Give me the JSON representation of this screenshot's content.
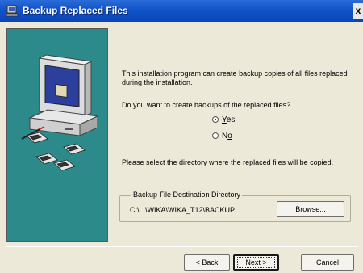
{
  "window": {
    "title": "Backup Replaced Files",
    "close_glyph": "x",
    "title_icon": "installer-icon"
  },
  "content": {
    "intro": "This installation program can create backup copies of all files replaced during the installation.",
    "question": "Do you want to create backups of the replaced files?",
    "radios": [
      {
        "label_prefix": "",
        "label_accel": "Y",
        "label_rest": "es",
        "checked": true
      },
      {
        "label_prefix": "N",
        "label_accel": "o",
        "label_rest": "",
        "checked": false
      }
    ],
    "select_dir_text": "Please select the directory where the replaced  files will be copied.",
    "group_label": "Backup File Destination Directory",
    "destination_path": "C:\\...\\WIKA\\WIKA_T12\\BACKUP",
    "browse_label": "Browse..."
  },
  "footer": {
    "back_label": "< Back",
    "next_label": "Next >",
    "cancel_label": "Cancel"
  },
  "colors": {
    "titlebar": "#1152c8",
    "side_panel": "#2d8a8a",
    "dialog_bg": "#ece9d8"
  }
}
